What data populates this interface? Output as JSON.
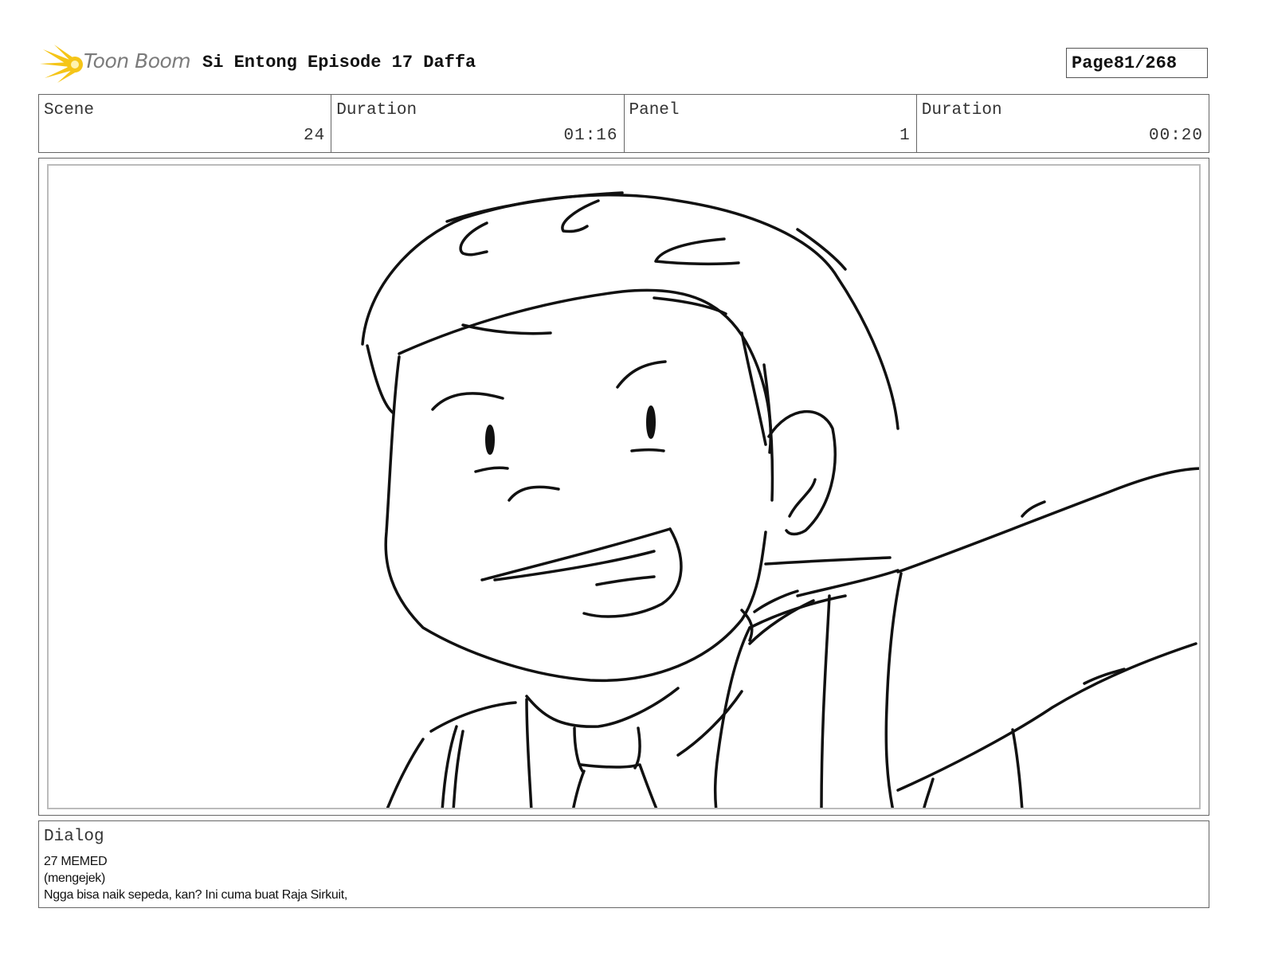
{
  "header": {
    "brand": "Toon Boom",
    "project_title": "Si Entong Episode 17 Daffa",
    "page_label": "Page",
    "page_value": "81/268"
  },
  "info": [
    {
      "label": "Scene",
      "value": "24"
    },
    {
      "label": "Duration",
      "value": "01:16"
    },
    {
      "label": "Panel",
      "value": "1"
    },
    {
      "label": "Duration",
      "value": "00:20"
    }
  ],
  "panel": {
    "icon": "sketch-boy-pointing"
  },
  "dialog": {
    "label": "Dialog",
    "lines": [
      "27 MEMED",
      "(mengejek)",
      "Ngga bisa naik sepeda, kan? Ini cuma buat Raja Sirkuit,"
    ]
  },
  "colors": {
    "logo_yellow": "#f5c518",
    "logo_text": "#7b7b7b",
    "border": "#666666"
  }
}
